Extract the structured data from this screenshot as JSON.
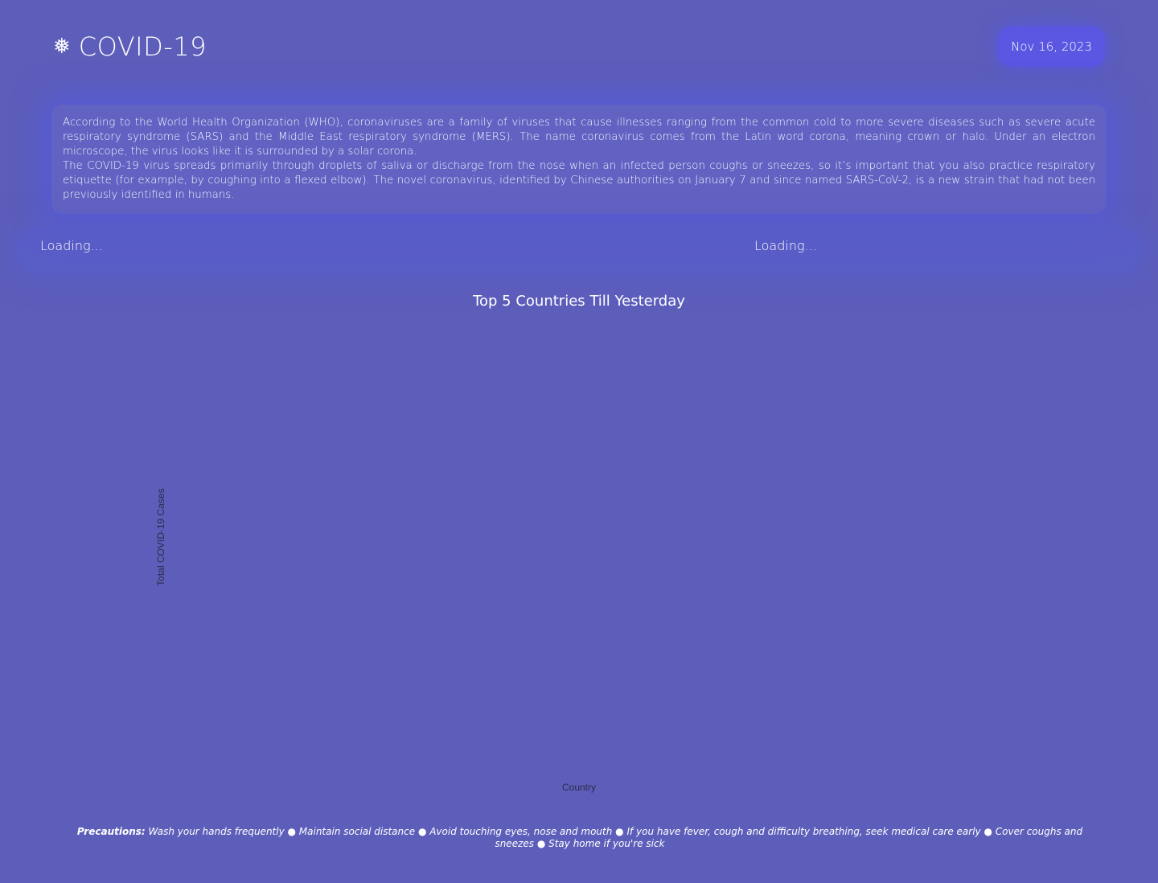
{
  "header": {
    "icon": "virus-icon",
    "icon_glyph": "❅",
    "title": "COVID-19",
    "date": "Nov 16, 2023"
  },
  "about": {
    "paragraph1": "According to the World Health Organization (WHO), coronaviruses are a family of viruses that cause illnesses ranging from the common cold to more severe diseases such as severe acute respiratory syndrome (SARS) and the Middle East respiratory syndrome (MERS). The name coronavirus comes from the Latin word corona, meaning crown or halo. Under an electron microscope, the virus looks like it is surrounded by a solar corona.",
    "paragraph2": "The COVID-19 virus spreads primarily through droplets of saliva or discharge from the nose when an infected person coughs or sneezes, so it’s important that you also practice respiratory etiquette (for example, by coughing into a flexed elbow). The novel coronavirus, identified by Chinese authorities on January 7 and since named SARS-CoV-2, is a new strain that had not been previously identified in humans."
  },
  "loading": {
    "left": "Loading...",
    "right": "Loading..."
  },
  "chart": {
    "title": "Top 5 Countries Till Yesterday",
    "ylabel": "Total COVID-19 Cases",
    "xlabel": "Country"
  },
  "footer": {
    "label": "Precautions:",
    "text": " Wash your hands frequently ● Maintain social distance ● Avoid touching eyes, nose and mouth ● If you have fever, cough and difficulty breathing, seek medical care early ● Cover coughs and sneezes ● Stay home if you're sick"
  },
  "colors": {
    "background": "#5d5eba",
    "accent": "#5b57e3",
    "text": "#ffffff"
  }
}
